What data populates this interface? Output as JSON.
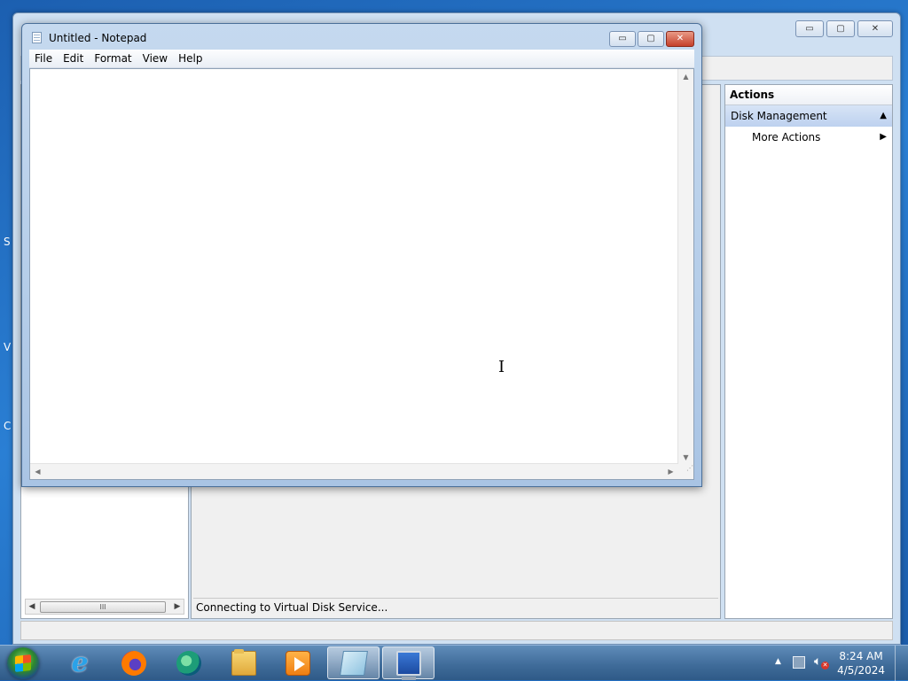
{
  "desktop": {
    "glyphs": [
      "S",
      "V",
      "C"
    ]
  },
  "computer_management": {
    "caption_buttons": {
      "minimize": "▭",
      "maximize": "▢",
      "close": "✕"
    },
    "status_text": "Connecting to Virtual Disk Service...",
    "scroll_thumb_grip": "III",
    "actions": {
      "header": "Actions",
      "section_label": "Disk Management",
      "more_actions_label": "More Actions"
    }
  },
  "notepad": {
    "title": "Untitled - Notepad",
    "menu": [
      "File",
      "Edit",
      "Format",
      "View",
      "Help"
    ],
    "caption_buttons": {
      "minimize": "▭",
      "maximize": "▢",
      "close": "✕"
    },
    "content": "",
    "cursor_glyph": "I"
  },
  "taskbar": {
    "pinned": [
      {
        "name": "internet-explorer",
        "icon": "ie-icon"
      },
      {
        "name": "firefox",
        "icon": "firefox-icon"
      },
      {
        "name": "edge",
        "icon": "edge-icon"
      },
      {
        "name": "file-explorer",
        "icon": "folder-icon"
      },
      {
        "name": "media-player",
        "icon": "media-player-icon"
      },
      {
        "name": "notepad",
        "icon": "notepad-icon",
        "active": true
      },
      {
        "name": "computer-management",
        "icon": "computer-management-icon",
        "active": true
      }
    ],
    "clock": {
      "time": "8:24 AM",
      "date": "4/5/2024"
    }
  }
}
